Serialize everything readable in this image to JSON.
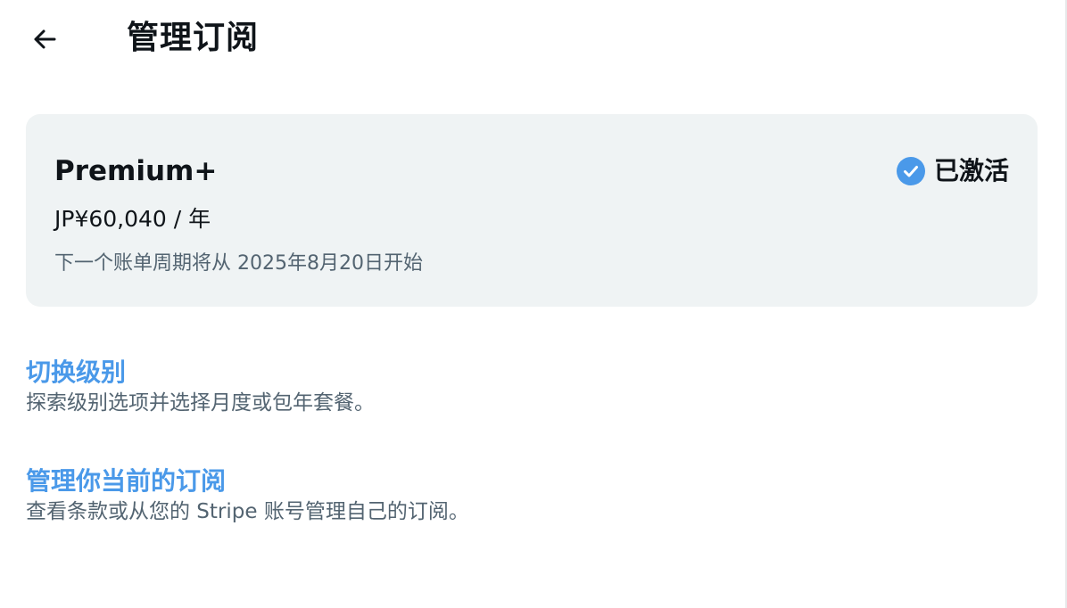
{
  "header": {
    "title": "管理订阅",
    "back_icon": "arrow-left-icon"
  },
  "plan": {
    "name": "Premium+",
    "price": "JP¥60,040 / 年",
    "billing_note": "下一个账单周期将从 2025年8月20日开始",
    "status_label": "已激活",
    "status_icon": "check-circle-icon",
    "status_color": "#4a99e9"
  },
  "options": [
    {
      "title": "切换级别",
      "description": "探索级别选项并选择月度或包年套餐。"
    },
    {
      "title": "管理你当前的订阅",
      "description": "查看条款或从您的 Stripe 账号管理自己的订阅。"
    }
  ],
  "colors": {
    "link": "#4a99e9",
    "card_background": "#eff3f4",
    "secondary_text": "#536471",
    "primary_text": "#0f1419"
  }
}
